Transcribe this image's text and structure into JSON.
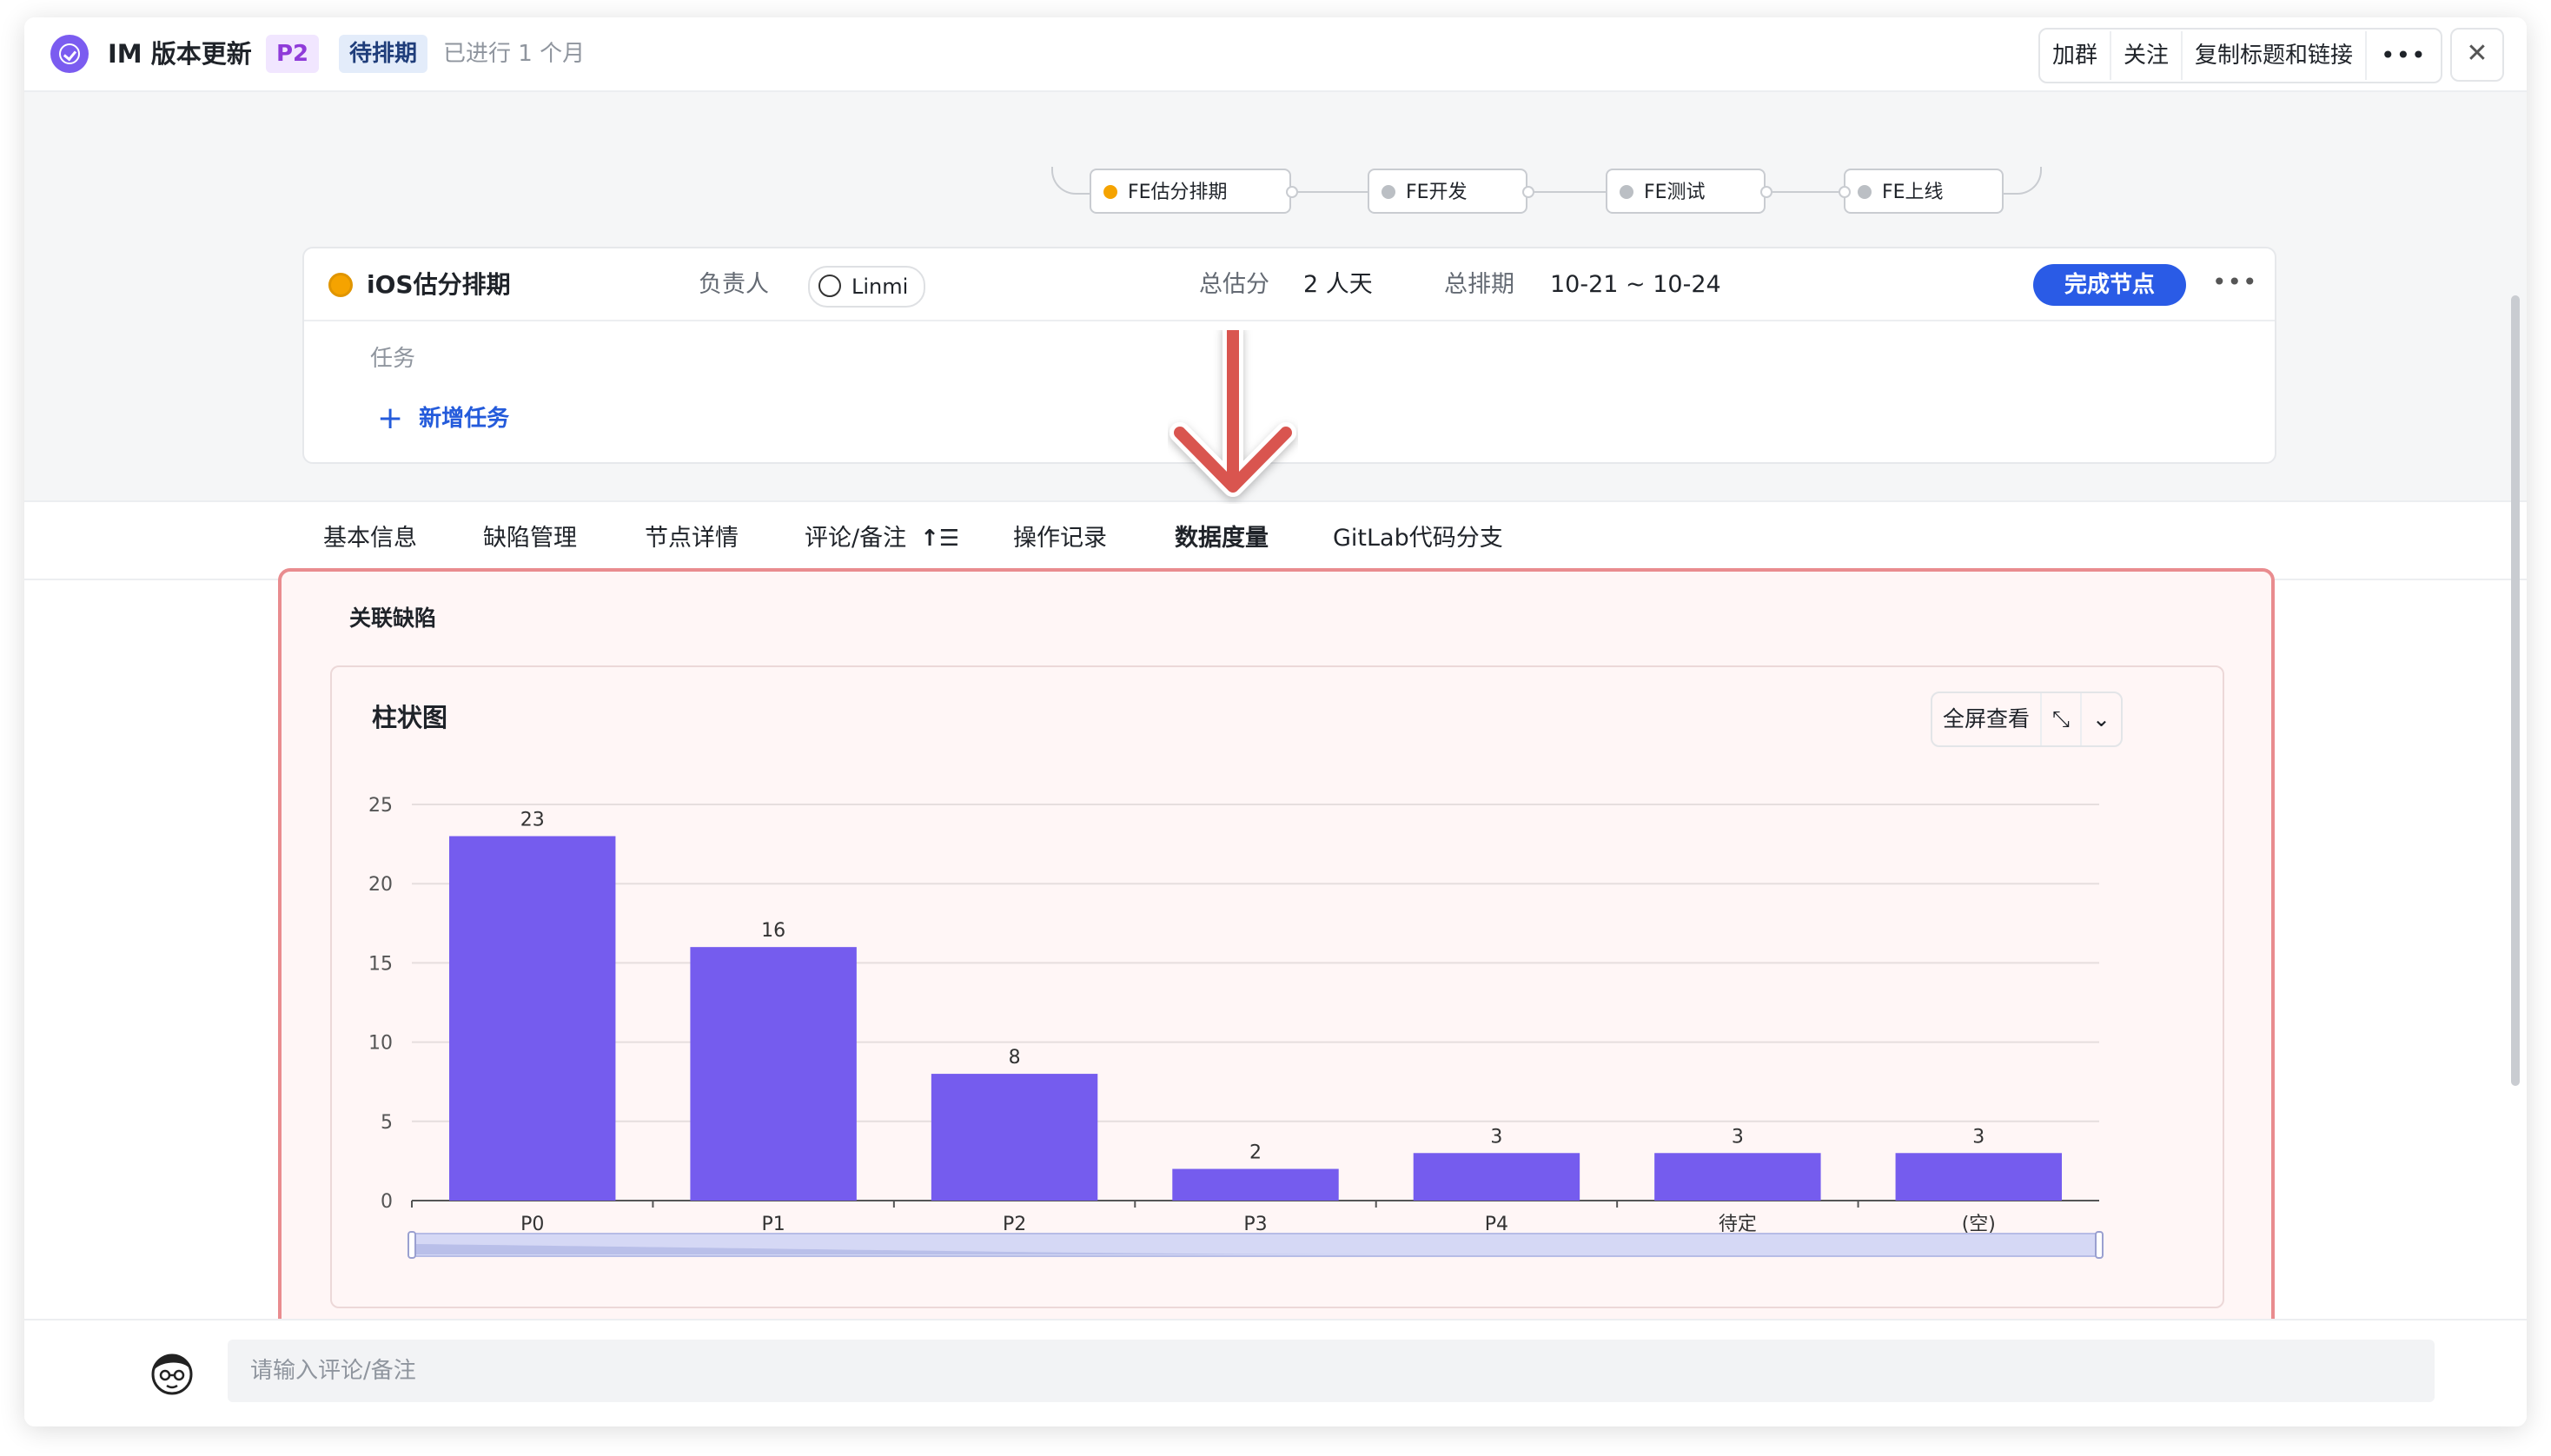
{
  "header": {
    "title": "IM 版本更新",
    "priority_tag": "P2",
    "status_tag": "待排期",
    "elapsed": "已进行 1 个月",
    "buttons": [
      "加群",
      "关注",
      "复制标题和链接",
      "•••"
    ],
    "close": "✕"
  },
  "flow": {
    "nodes": [
      {
        "label": "FE估分排期",
        "active": true
      },
      {
        "label": "FE开发",
        "active": false
      },
      {
        "label": "FE测试",
        "active": false
      },
      {
        "label": "FE上线",
        "active": false
      }
    ]
  },
  "task_card": {
    "node_name": "iOS估分排期",
    "owner_label": "负责人",
    "owner": "Linmi",
    "estimate_label": "总估分",
    "estimate": "2 人天",
    "schedule_label": "总排期",
    "schedule": "10-21 ~ 10-24",
    "complete_button": "完成节点",
    "more": "•••",
    "task_label": "任务",
    "add_task": "新增任务",
    "add_icon": "+",
    "status_color": "#f5a300"
  },
  "tabs": {
    "items": [
      "基本信息",
      "缺陷管理",
      "节点详情",
      "评论/备注",
      "操作记录",
      "数据度量",
      "GitLab代码分支"
    ],
    "active": "数据度量",
    "sort_icon": "↑☰"
  },
  "panel": {
    "title": "关联缺陷",
    "chart_title": "柱状图",
    "tools": {
      "fullscreen": "全屏查看",
      "expand_icon": "⤡",
      "dropdown_icon": "⌄"
    }
  },
  "chart_data": {
    "type": "bar",
    "title": "柱状图",
    "xlabel": "",
    "ylabel": "",
    "categories": [
      "P0",
      "P1",
      "P2",
      "P3",
      "P4",
      "待定",
      "(空)"
    ],
    "values": [
      23,
      16,
      8,
      2,
      3,
      3,
      3
    ],
    "ylim": [
      0,
      25
    ],
    "yticks": [
      0,
      5,
      10,
      15,
      20,
      25
    ],
    "grid": true,
    "bar_color": "#755cee",
    "data_labels": true
  },
  "comment": {
    "placeholder": "请输入评论/备注"
  },
  "colors": {
    "accent": "#2a5be6",
    "highlight_border": "#e98c8f",
    "arrow": "#d95450"
  }
}
